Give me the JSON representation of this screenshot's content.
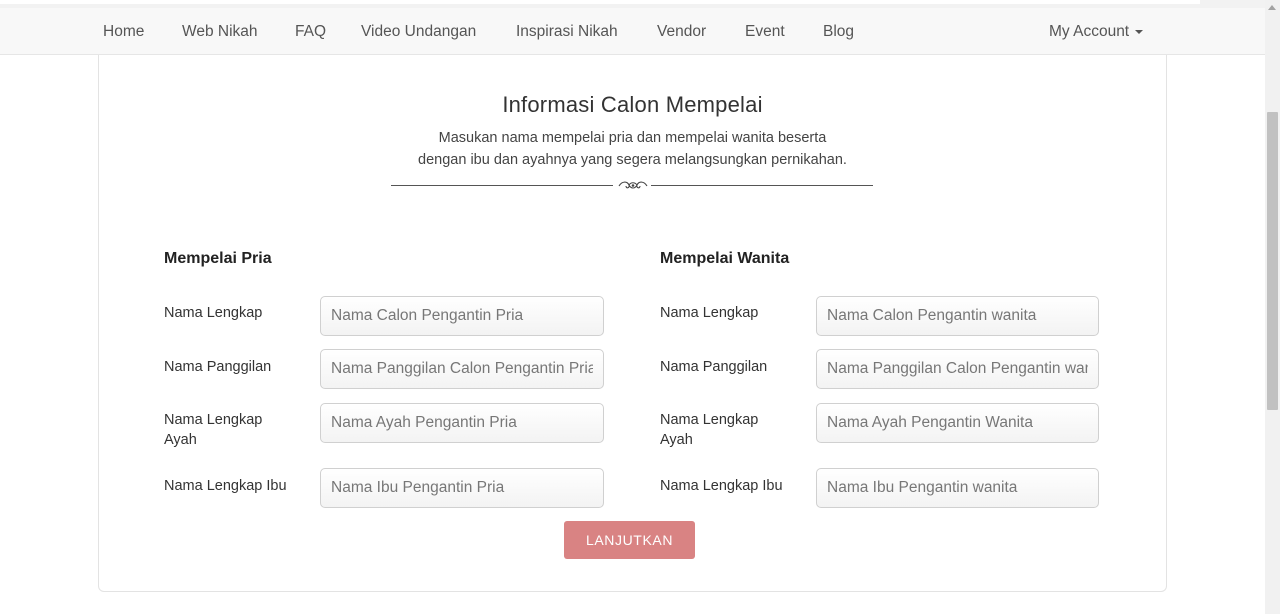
{
  "nav": {
    "items": [
      "Home",
      "Web Nikah",
      "FAQ",
      "Video Undangan",
      "Inspirasi Nikah",
      "Vendor",
      "Event",
      "Blog"
    ],
    "account": "My Account"
  },
  "form": {
    "title": "Informasi Calon Mempelai",
    "subtitle_line1": "Masukan nama mempelai pria dan mempelai wanita beserta",
    "subtitle_line2": "dengan ibu dan ayahnya yang segera melangsungkan pernikahan.",
    "groom": {
      "title": "Mempelai Pria",
      "fields": [
        {
          "label": "Nama Lengkap",
          "placeholder": "Nama Calon Pengantin Pria",
          "value": ""
        },
        {
          "label": "Nama Panggilan",
          "placeholder": "Nama Panggilan Calon Pengantin Pria",
          "value": ""
        },
        {
          "label": "Nama Lengkap Ayah",
          "placeholder": "Nama Ayah Pengantin Pria",
          "value": ""
        },
        {
          "label": "Nama Lengkap Ibu",
          "placeholder": "Nama Ibu Pengantin Pria",
          "value": ""
        }
      ]
    },
    "bride": {
      "title": "Mempelai Wanita",
      "fields": [
        {
          "label": "Nama Lengkap",
          "placeholder": "Nama Calon Pengantin wanita",
          "value": ""
        },
        {
          "label": "Nama Panggilan",
          "placeholder": "Nama Panggilan Calon Pengantin wanita",
          "value": ""
        },
        {
          "label": "Nama Lengkap Ayah",
          "placeholder": "Nama Ayah Pengantin Wanita",
          "value": ""
        },
        {
          "label": "Nama Lengkap Ibu",
          "placeholder": "Nama Ibu Pengantin wanita",
          "value": ""
        }
      ]
    },
    "submit_label": "LANJUTKAN"
  },
  "colors": {
    "button": "#d98383",
    "navbar": "#f8f8f8"
  },
  "icons": {
    "divider_ornament": "floral-ornament-icon",
    "account_caret": "caret-down-icon"
  }
}
